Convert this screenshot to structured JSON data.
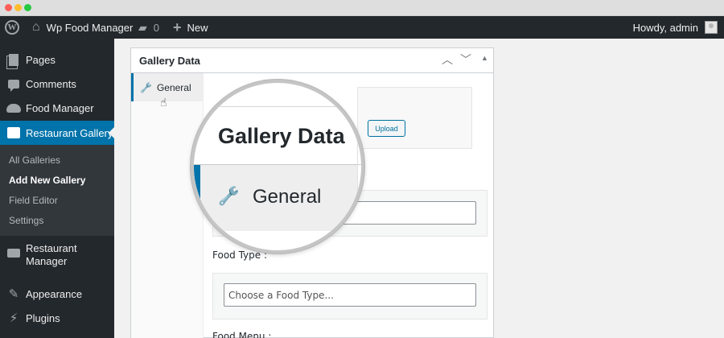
{
  "admin_bar": {
    "site_name": "Wp Food Manager",
    "comments_count": "0",
    "new_label": "New",
    "howdy": "Howdy, admin"
  },
  "sidebar": {
    "items": [
      {
        "label": "Pages",
        "icon": "pages-icon"
      },
      {
        "label": "Comments",
        "icon": "comments-icon"
      },
      {
        "label": "Food Manager",
        "icon": "food-manager-icon"
      },
      {
        "label": "Restaurant Gallery",
        "icon": "gallery-icon",
        "current": true
      },
      {
        "label": "Restaurant Manager",
        "icon": "truck-icon"
      },
      {
        "label": "Appearance",
        "icon": "appearance-icon"
      },
      {
        "label": "Plugins",
        "icon": "plugins-icon"
      }
    ],
    "submenu": [
      "All Galleries",
      "Add New Gallery",
      "Field Editor",
      "Settings"
    ],
    "active_submenu": "Add New Gallery"
  },
  "metabox": {
    "title": "Gallery Data",
    "tabs": [
      {
        "label": "General",
        "active": true
      }
    ],
    "upload_button": "Upload",
    "fields": [
      {
        "label": "Food Type :",
        "placeholder": "Choose a Food Type..."
      },
      {
        "label": "Food Menu :"
      }
    ]
  },
  "magnifier": {
    "title": "Gallery Data",
    "tab_label": "General"
  },
  "colors": {
    "admin_bg": "#23282d",
    "accent": "#0073aa",
    "submenu_bg": "#32373c",
    "page_bg": "#f1f1f1"
  }
}
